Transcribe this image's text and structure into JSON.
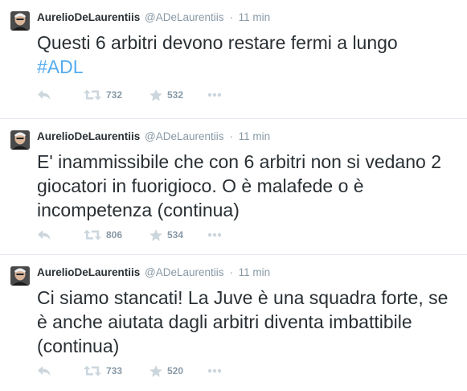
{
  "tweets": [
    {
      "author": {
        "fullname": "AurelioDeLaurentiis",
        "username": "@ADeLaurentiis"
      },
      "separator": "·",
      "time": "11 min",
      "text": "Questi 6 arbitri devono restare fermi a lungo ",
      "hashtag": "#ADL",
      "retweets": "732",
      "favorites": "532",
      "icons": [
        "reply-icon",
        "retweet-icon",
        "favorite-star-icon",
        "more-dots-icon"
      ]
    },
    {
      "author": {
        "fullname": "AurelioDeLaurentiis",
        "username": "@ADeLaurentiis"
      },
      "separator": "·",
      "time": "11 min",
      "text": "E' inammissibile che con 6 arbitri non si vedano 2 giocatori in fuorigioco. O è malafede o è incompetenza (continua)",
      "retweets": "806",
      "favorites": "534",
      "icons": [
        "reply-icon",
        "retweet-icon",
        "favorite-star-icon",
        "more-dots-icon"
      ]
    },
    {
      "author": {
        "fullname": "AurelioDeLaurentiis",
        "username": "@ADeLaurentiis"
      },
      "separator": "·",
      "time": "11 min",
      "text": "Ci siamo stancati! La Juve è una squadra forte, se è anche aiutata dagli arbitri diventa imbattibile (continua)",
      "retweets": "733",
      "favorites": "520",
      "icons": [
        "reply-icon",
        "retweet-icon",
        "favorite-star-icon",
        "more-dots-icon"
      ]
    }
  ],
  "colors": {
    "text": "#292f33",
    "meta": "#8899a6",
    "hashtag": "#55acee",
    "action_icon": "#ccd6dd",
    "divider": "#e1e8ed"
  }
}
